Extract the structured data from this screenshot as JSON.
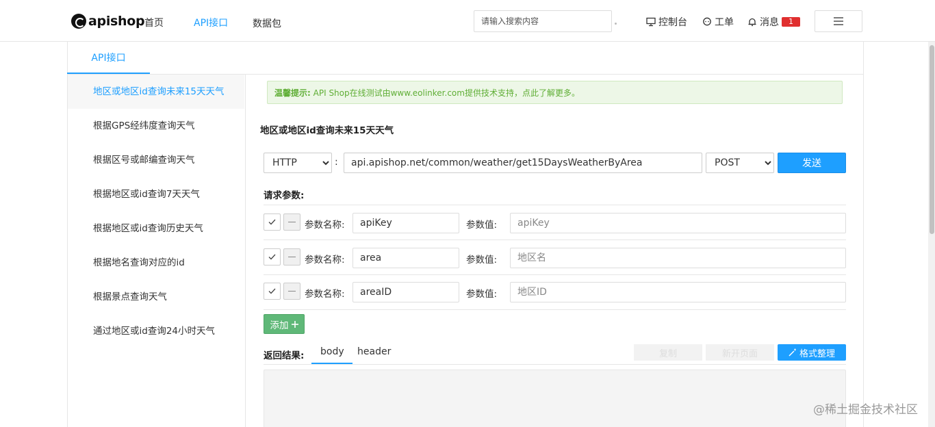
{
  "header": {
    "logo_text": "apishop",
    "nav": [
      "首页",
      "API接口",
      "数据包"
    ],
    "search_placeholder": "请输入搜索内容",
    "console": "控制台",
    "ticket": "工单",
    "messages": "消息",
    "message_count": "1"
  },
  "main_tab": "API接口",
  "sidebar": {
    "items": [
      "地区或地区id查询未来15天天气",
      "根据GPS经纬度查询天气",
      "根据区号或邮编查询天气",
      "根据地区或id查询7天天气",
      "根据地区或id查询历史天气",
      "根据地名查询对应的id",
      "根据景点查询天气",
      "通过地区或id查询24小时天气"
    ]
  },
  "notice": {
    "label": "温馨提示:",
    "text": "API Shop在线测试由www.eolinker.com提供技术支持，点此了解更多。"
  },
  "api_title": "地区或地区id查询未来15天天气",
  "request": {
    "protocol": "HTTP",
    "url": "api.apishop.net/common/weather/get15DaysWeatherByArea",
    "method": "POST",
    "send_label": "发送"
  },
  "params": {
    "section_label": "请求参数:",
    "name_label": "参数名称:",
    "value_label": "参数值:",
    "rows": [
      {
        "name": "apiKey",
        "value_placeholder": "apiKey"
      },
      {
        "name": "area",
        "value_placeholder": "地区名"
      },
      {
        "name": "areaID",
        "value_placeholder": "地区ID"
      }
    ],
    "add_label": "添加"
  },
  "result": {
    "label": "返回结果:",
    "tabs": [
      "body",
      "header"
    ],
    "copy": "复制",
    "open_new": "新开页面",
    "format": "格式整理"
  },
  "watermark": "@稀土掘金技术社区",
  "colors": {
    "accent": "#1e9fff",
    "add_green": "#5fb878",
    "badge_red": "#e02f2f"
  }
}
